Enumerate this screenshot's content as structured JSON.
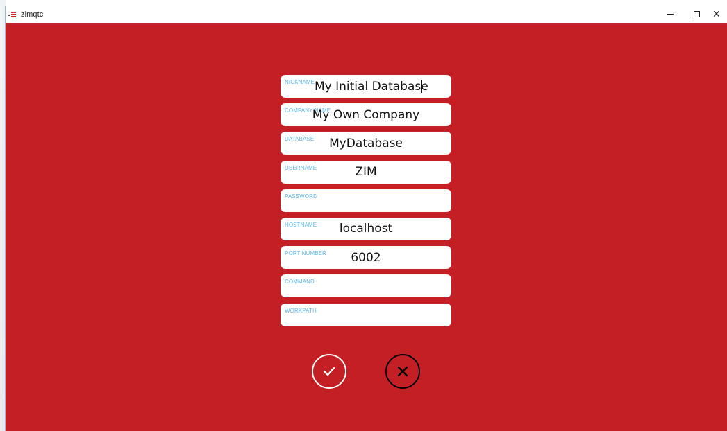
{
  "window": {
    "title": "zimqtc",
    "icon": "app-menu-icon"
  },
  "form": {
    "fields": [
      {
        "label": "NICKNAME",
        "value": "My Initial Database",
        "placeholder": ""
      },
      {
        "label": "COMPANY NAME",
        "value": "My Own Company",
        "placeholder": ""
      },
      {
        "label": "DATABASE",
        "value": "MyDatabase",
        "placeholder": ""
      },
      {
        "label": "USERNAME",
        "value": "ZIM",
        "placeholder": ""
      },
      {
        "label": "PASSWORD",
        "value": "",
        "placeholder": ""
      },
      {
        "label": "HOSTNAME",
        "value": "localhost",
        "placeholder": ""
      },
      {
        "label": "PORT NUMBER",
        "value": "6002",
        "placeholder": ""
      },
      {
        "label": "COMMAND",
        "value": "",
        "placeholder": ""
      },
      {
        "label": "WORKPATH",
        "value": "",
        "placeholder": ""
      }
    ]
  },
  "actions": {
    "confirm_icon": "checkmark-circle-icon",
    "cancel_icon": "x-circle-icon"
  },
  "colors": {
    "background": "#c41f25",
    "label": "#5cb8e6",
    "field_bg": "#ffffff",
    "confirm": "#ffffff",
    "cancel": "#000000"
  }
}
